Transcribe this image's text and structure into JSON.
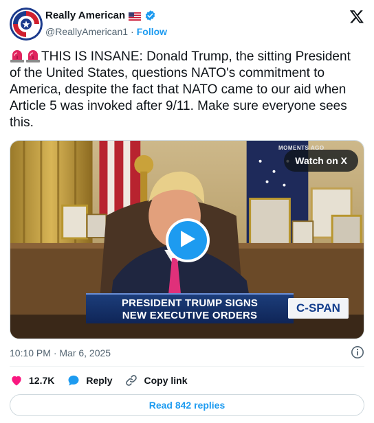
{
  "author": {
    "name": "Really American",
    "flag_emoji": "us-flag",
    "handle": "@ReallyAmerican1",
    "separator": "·",
    "follow_label": "Follow",
    "verified": true
  },
  "tweet": {
    "text": "THIS IS INSANE: Donald Trump, the sitting President of the United States, questions NATO's commitment to America, despite the fact that NATO came to our aid when Article 5 was invoked after 9/11. Make sure everyone sees this.",
    "leading_icons": [
      "siren-icon",
      "siren-icon"
    ]
  },
  "media": {
    "watch_label": "Watch on X",
    "chyron_line1": "PRESIDENT TRUMP SIGNS",
    "chyron_line2": "NEW EXECUTIVE ORDERS",
    "network_logo": "C-SPAN",
    "corner_text": "MOMENTS AGO"
  },
  "timestamp": "10:10 PM · Mar 6, 2025",
  "actions": {
    "likes": "12.7K",
    "reply_label": "Reply",
    "copy_link_label": "Copy link"
  },
  "replies_button": "Read 842 replies",
  "colors": {
    "accent": "#1d9bf0",
    "like": "#f91880",
    "secondary_text": "#536471",
    "chyron_blue": "#1c3d7a"
  }
}
